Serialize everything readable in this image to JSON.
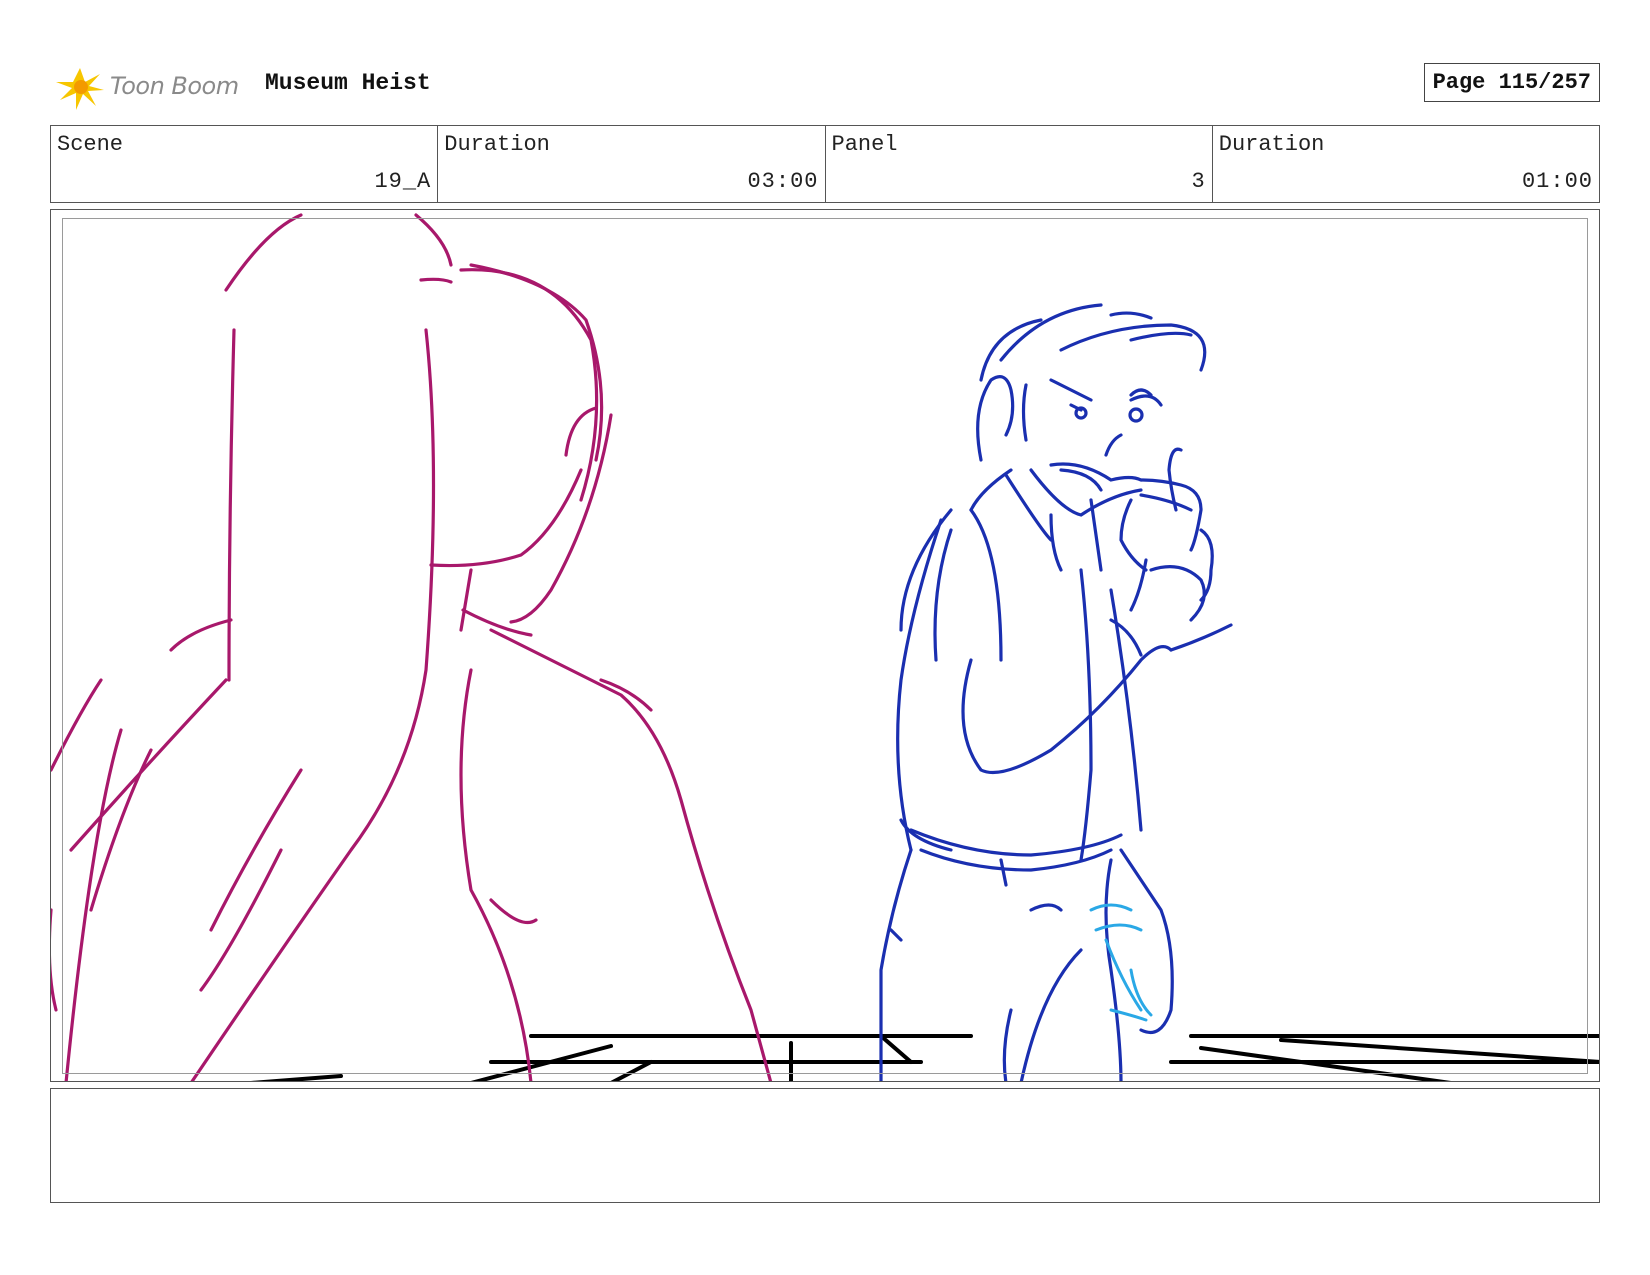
{
  "header": {
    "logo_text": "Toon Boom",
    "project_title": "Museum Heist",
    "page_label": "Page 115/257"
  },
  "info": {
    "scene_label": "Scene",
    "scene_value": "19_A",
    "scene_duration_label": "Duration",
    "scene_duration_value": "03:00",
    "panel_label": "Panel",
    "panel_value": "3",
    "panel_duration_label": "Duration",
    "panel_duration_value": "01:00"
  },
  "panel": {
    "sketch_colors": {
      "foreground_character": "#a8186b",
      "background_character": "#1a2fb0",
      "accent": "#2aa8e6",
      "floor_lines": "#000000"
    }
  },
  "notes": {
    "text": ""
  }
}
